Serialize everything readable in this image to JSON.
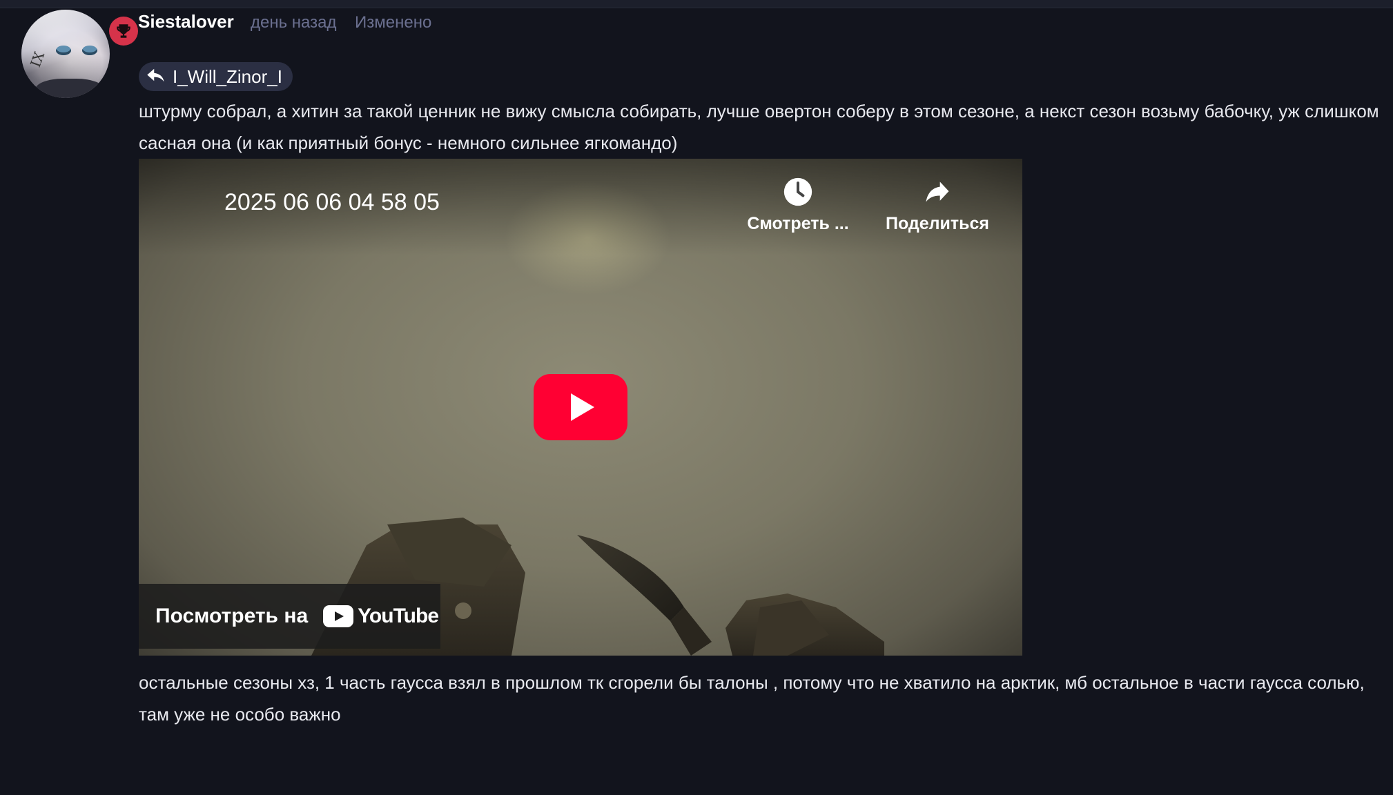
{
  "comment": {
    "username": "Siestalover",
    "time": "день назад",
    "edited": "Изменено",
    "reply_to": "I_Will_Zinor_I",
    "text_before": "штурму собрал, а хитин за такой ценник не вижу смысла собирать, лучше овертон соберу в этом сезоне, а некст сезон возьму бабочку, уж слишком сасная она (и как приятный бонус - немного сильнее ягкомандо)",
    "text_after": "остальные сезоны хз, 1 часть гаусса взял в прошлом тк сгорели бы талоны , потому что не хватило на арктик, мб остальное в части гаусса солью, там уже не особо важно",
    "badge_icon": "trophy-icon",
    "badge_color": "#d6334a"
  },
  "video": {
    "title": "2025 06 06 04 58 05",
    "watch_later_label": "Смотреть ...",
    "share_label": "Поделиться",
    "watch_on_label": "Посмотреть на",
    "youtube_label": "YouTube",
    "play_color": "#ff0033"
  },
  "colors": {
    "background": "#12141d",
    "meta_text": "#6b7090",
    "chip_bg": "#2b2f43"
  }
}
